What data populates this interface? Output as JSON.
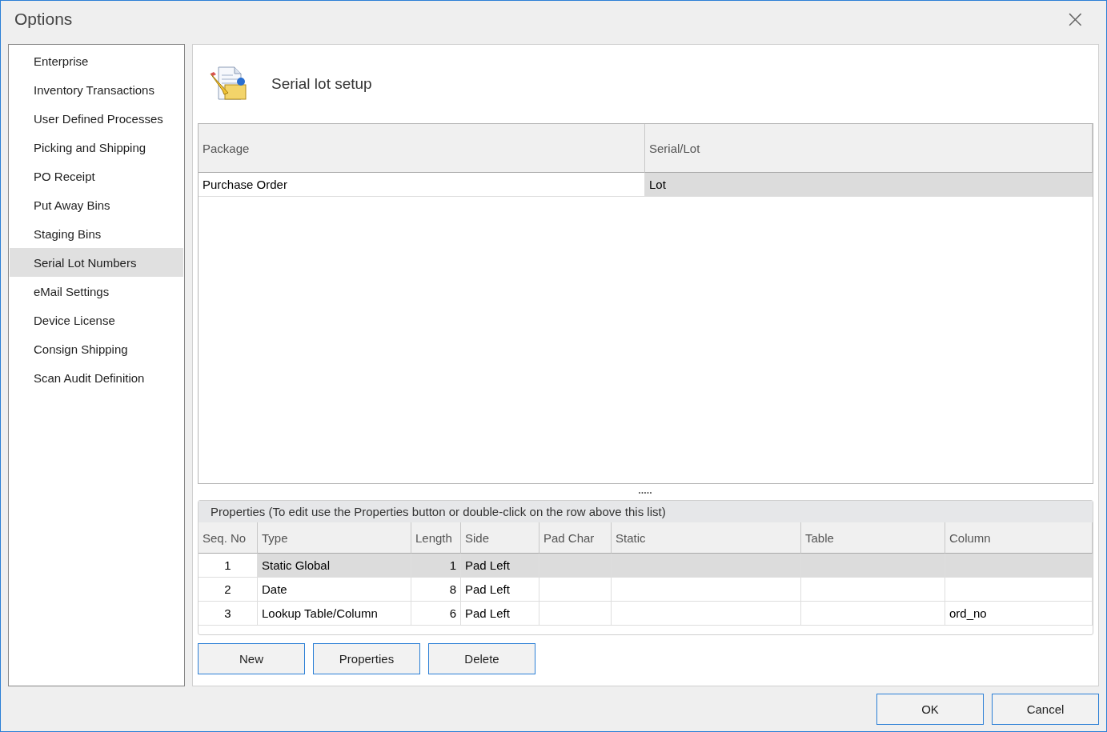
{
  "window": {
    "title": "Options",
    "close": "×"
  },
  "sidebar": {
    "items": [
      {
        "label": "Enterprise",
        "selected": false
      },
      {
        "label": "Inventory Transactions",
        "selected": false
      },
      {
        "label": "User Defined Processes",
        "selected": false
      },
      {
        "label": "Picking and Shipping",
        "selected": false
      },
      {
        "label": "PO Receipt",
        "selected": false
      },
      {
        "label": "Put Away Bins",
        "selected": false
      },
      {
        "label": "Staging Bins",
        "selected": false
      },
      {
        "label": "Serial Lot Numbers",
        "selected": true
      },
      {
        "label": "eMail Settings",
        "selected": false
      },
      {
        "label": "Device License",
        "selected": false
      },
      {
        "label": "Consign Shipping",
        "selected": false
      },
      {
        "label": "Scan Audit Definition",
        "selected": false
      }
    ]
  },
  "panel": {
    "title": "Serial lot setup"
  },
  "package_table": {
    "columns": [
      "Package",
      "Serial/Lot"
    ],
    "rows": [
      {
        "cells": [
          {
            "text": "Purchase Order",
            "selected": false
          },
          {
            "text": "Lot",
            "selected": true
          }
        ]
      }
    ]
  },
  "splitter": "•••••",
  "properties": {
    "caption": "Properties  (To edit use the Properties button or double-click on the row above this list)",
    "columns": [
      "Seq. No",
      "Type",
      "Length",
      "Side",
      "Pad Char",
      "Static",
      "Table",
      "Column"
    ],
    "rows": [
      {
        "selected": true,
        "cells": [
          "1",
          "Static Global",
          "1",
          "Pad Left",
          "",
          "",
          "",
          ""
        ]
      },
      {
        "selected": false,
        "cells": [
          "2",
          "Date",
          "8",
          "Pad Left",
          "",
          "",
          "",
          ""
        ]
      },
      {
        "selected": false,
        "cells": [
          "3",
          "Lookup Table/Column",
          "6",
          "Pad Left",
          "",
          "",
          "",
          "ord_no"
        ]
      }
    ],
    "buttons": [
      "New",
      "Properties",
      "Delete"
    ]
  },
  "footer_buttons": [
    "OK",
    "Cancel"
  ]
}
